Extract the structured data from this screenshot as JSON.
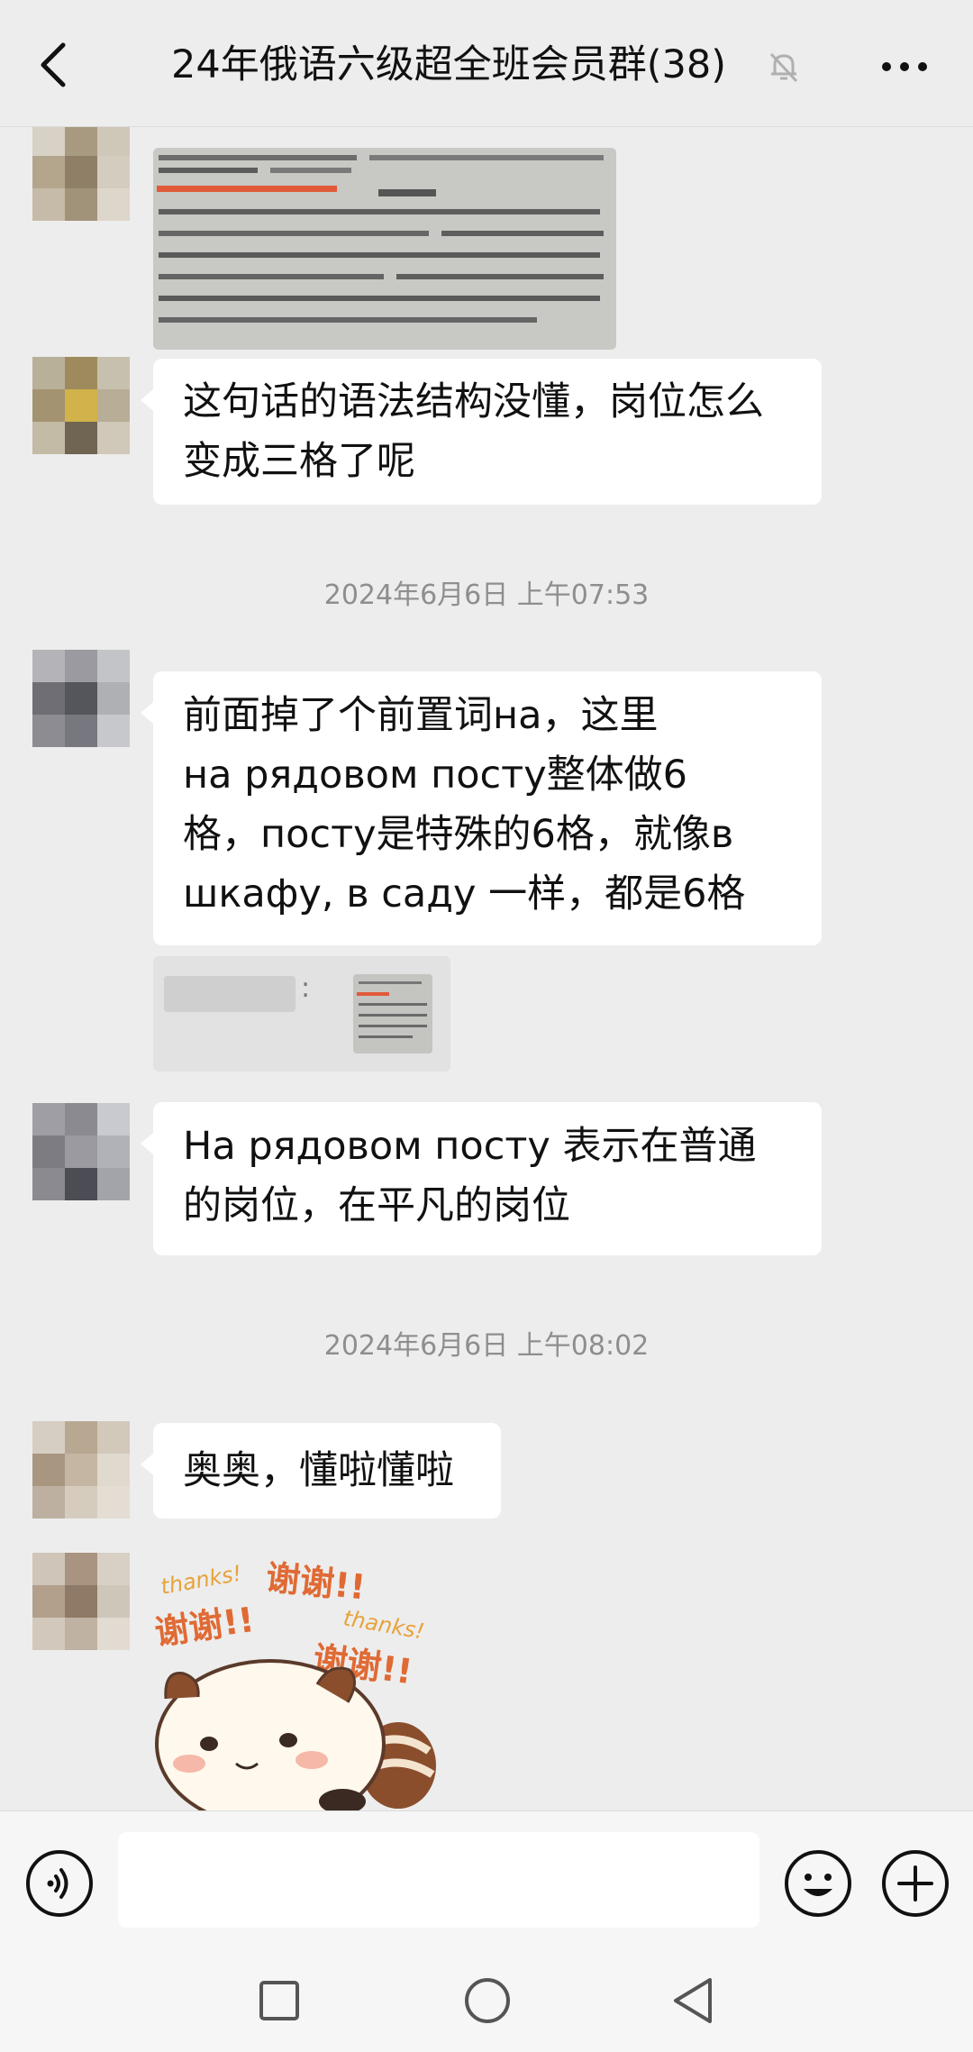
{
  "header": {
    "title": "24年俄语六级超全班会员群(38)",
    "back_icon": "chevron-left-icon",
    "mute_icon": "bell-muted-icon",
    "more_icon": "ellipsis-icon"
  },
  "messages": [
    {
      "type": "image",
      "description_icon": "photo-icon"
    },
    {
      "type": "text",
      "lines": [
        "这句话的语法结构没懂，岗位怎么",
        "变成三格了呢"
      ]
    },
    {
      "type": "timestamp",
      "text": "2024年6月6日 上午07:53"
    },
    {
      "type": "text",
      "lines": [
        "前面掉了个前置词на，这里",
        "на рядовом посту整体做6",
        "格，посту是特殊的6格，就像в",
        "шкафу, в саду 一样，都是6格"
      ]
    },
    {
      "type": "quote",
      "prefix": ":"
    },
    {
      "type": "text",
      "lines": [
        "На рядовом посту 表示在普通",
        "的岗位，在平凡的岗位"
      ]
    },
    {
      "type": "timestamp",
      "text": "2024年6月6日 上午08:02"
    },
    {
      "type": "text",
      "lines": [
        "奥奥，懂啦懂啦"
      ]
    },
    {
      "type": "sticker",
      "texts": [
        "thanks!",
        "谢谢!!",
        "谢谢!!",
        "thanks!",
        "谢谢!!"
      ]
    }
  ],
  "input_bar": {
    "voice_icon": "voice-icon",
    "placeholder": "",
    "emoji_icon": "emoji-icon",
    "plus_icon": "plus-circle-icon"
  },
  "nav_bar": {
    "recent_icon": "square-icon",
    "home_icon": "circle-icon",
    "back_icon": "triangle-back-icon"
  },
  "colors": {
    "background": "#ededed",
    "bubble": "#ffffff",
    "timestamp": "#8e8e8e",
    "icon": "#111111"
  }
}
